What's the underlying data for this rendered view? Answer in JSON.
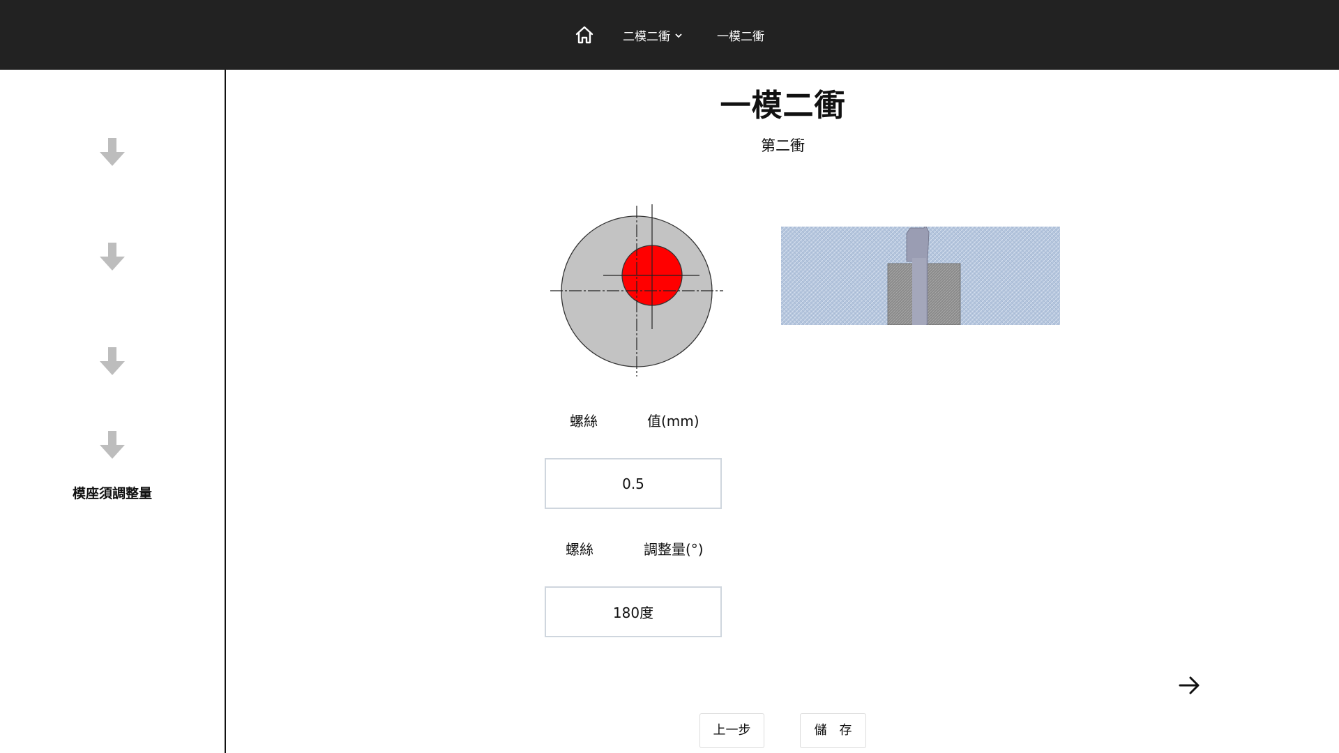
{
  "nav": {
    "home_icon": "home-icon",
    "item1_label": "二模二衝",
    "item1_icon": "chevron-down-icon",
    "item2_label": "一模二衝"
  },
  "sidebar": {
    "arrow_icon": "arrow-down-icon",
    "step_label": "模座須調整量"
  },
  "page": {
    "title": "一模二衝",
    "subtitle": "第二衝"
  },
  "fields": {
    "screw_label_1a": "螺絲",
    "screw_label_1b": "值(mm)",
    "screw_value_1": "0.5",
    "screw_label_2a": "螺絲",
    "screw_label_2b": "調整量(°)",
    "screw_value_2": "180度"
  },
  "buttons": {
    "prev_label": "上一步",
    "save_label": "儲　存",
    "next_icon": "arrow-right-icon"
  },
  "colors": {
    "topbar": "#222222",
    "target_dot": "#ff0000",
    "disc": "#c3c3c3"
  }
}
